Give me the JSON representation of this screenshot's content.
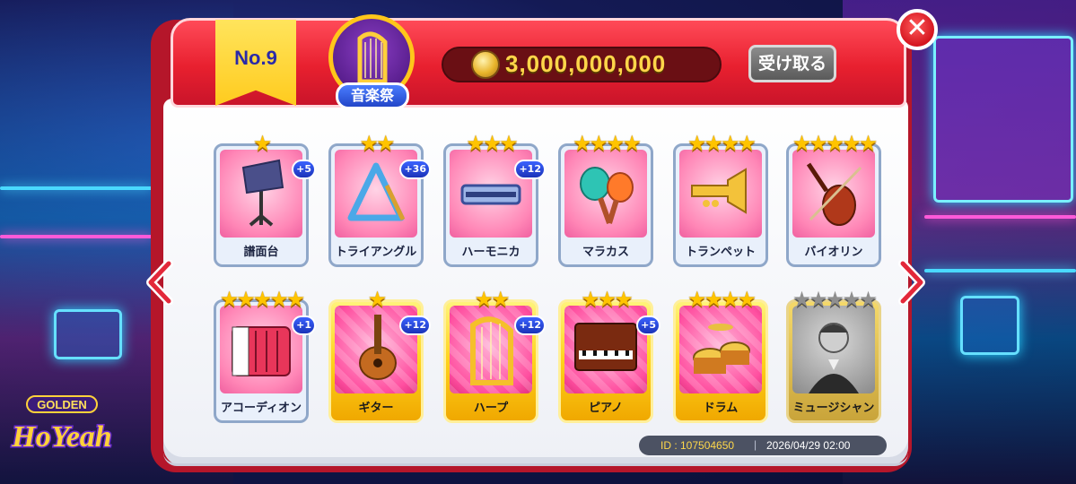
{
  "header": {
    "rank_label": "No.9",
    "category_label": "音楽祭",
    "coin_amount": "3,000,000,000",
    "receive_label": "受け取る",
    "close_label": "✕"
  },
  "nav": {
    "prev_icon": "chevron-left-icon",
    "next_icon": "chevron-right-icon"
  },
  "cards": [
    {
      "name": "譜面台",
      "stars": 1,
      "max_stars": 1,
      "bonus": "+5",
      "style": "normal",
      "icon": "music-stand-icon"
    },
    {
      "name": "トライアングル",
      "stars": 2,
      "max_stars": 2,
      "bonus": "+36",
      "style": "normal",
      "icon": "triangle-icon"
    },
    {
      "name": "ハーモニカ",
      "stars": 3,
      "max_stars": 3,
      "bonus": "+12",
      "style": "normal",
      "icon": "harmonica-icon"
    },
    {
      "name": "マラカス",
      "stars": 4,
      "max_stars": 4,
      "bonus": "",
      "style": "normal",
      "icon": "maracas-icon"
    },
    {
      "name": "トランペット",
      "stars": 4,
      "max_stars": 4,
      "bonus": "",
      "style": "normal",
      "icon": "trumpet-icon"
    },
    {
      "name": "バイオリン",
      "stars": 5,
      "max_stars": 5,
      "bonus": "",
      "style": "normal",
      "icon": "violin-icon"
    },
    {
      "name": "アコーディオン",
      "stars": 5,
      "max_stars": 5,
      "bonus": "+1",
      "style": "normal",
      "icon": "accordion-icon"
    },
    {
      "name": "ギター",
      "stars": 1,
      "max_stars": 1,
      "bonus": "+12",
      "style": "gold",
      "icon": "guitar-icon"
    },
    {
      "name": "ハープ",
      "stars": 2,
      "max_stars": 2,
      "bonus": "+12",
      "style": "gold",
      "icon": "harp-icon"
    },
    {
      "name": "ピアノ",
      "stars": 3,
      "max_stars": 3,
      "bonus": "+5",
      "style": "gold",
      "icon": "piano-icon"
    },
    {
      "name": "ドラム",
      "stars": 4,
      "max_stars": 4,
      "bonus": "",
      "style": "gold",
      "icon": "drum-icon"
    },
    {
      "name": "ミュージシャン",
      "stars": 0,
      "max_stars": 5,
      "bonus": "",
      "style": "grey",
      "icon": "conductor-portrait"
    }
  ],
  "footer": {
    "id_label": "ID : 107504650",
    "separator": "|",
    "date": "2026/04/29 02:00"
  },
  "logo": {
    "top": "GOLDEN",
    "main": "HoYeah"
  },
  "colors": {
    "panel_red": "#e8202f",
    "ribbon_yellow": "#ffcb1e",
    "coin_text": "#ffd54a",
    "star": "#ffc400",
    "bonus_badge": "#2a4bdc"
  }
}
